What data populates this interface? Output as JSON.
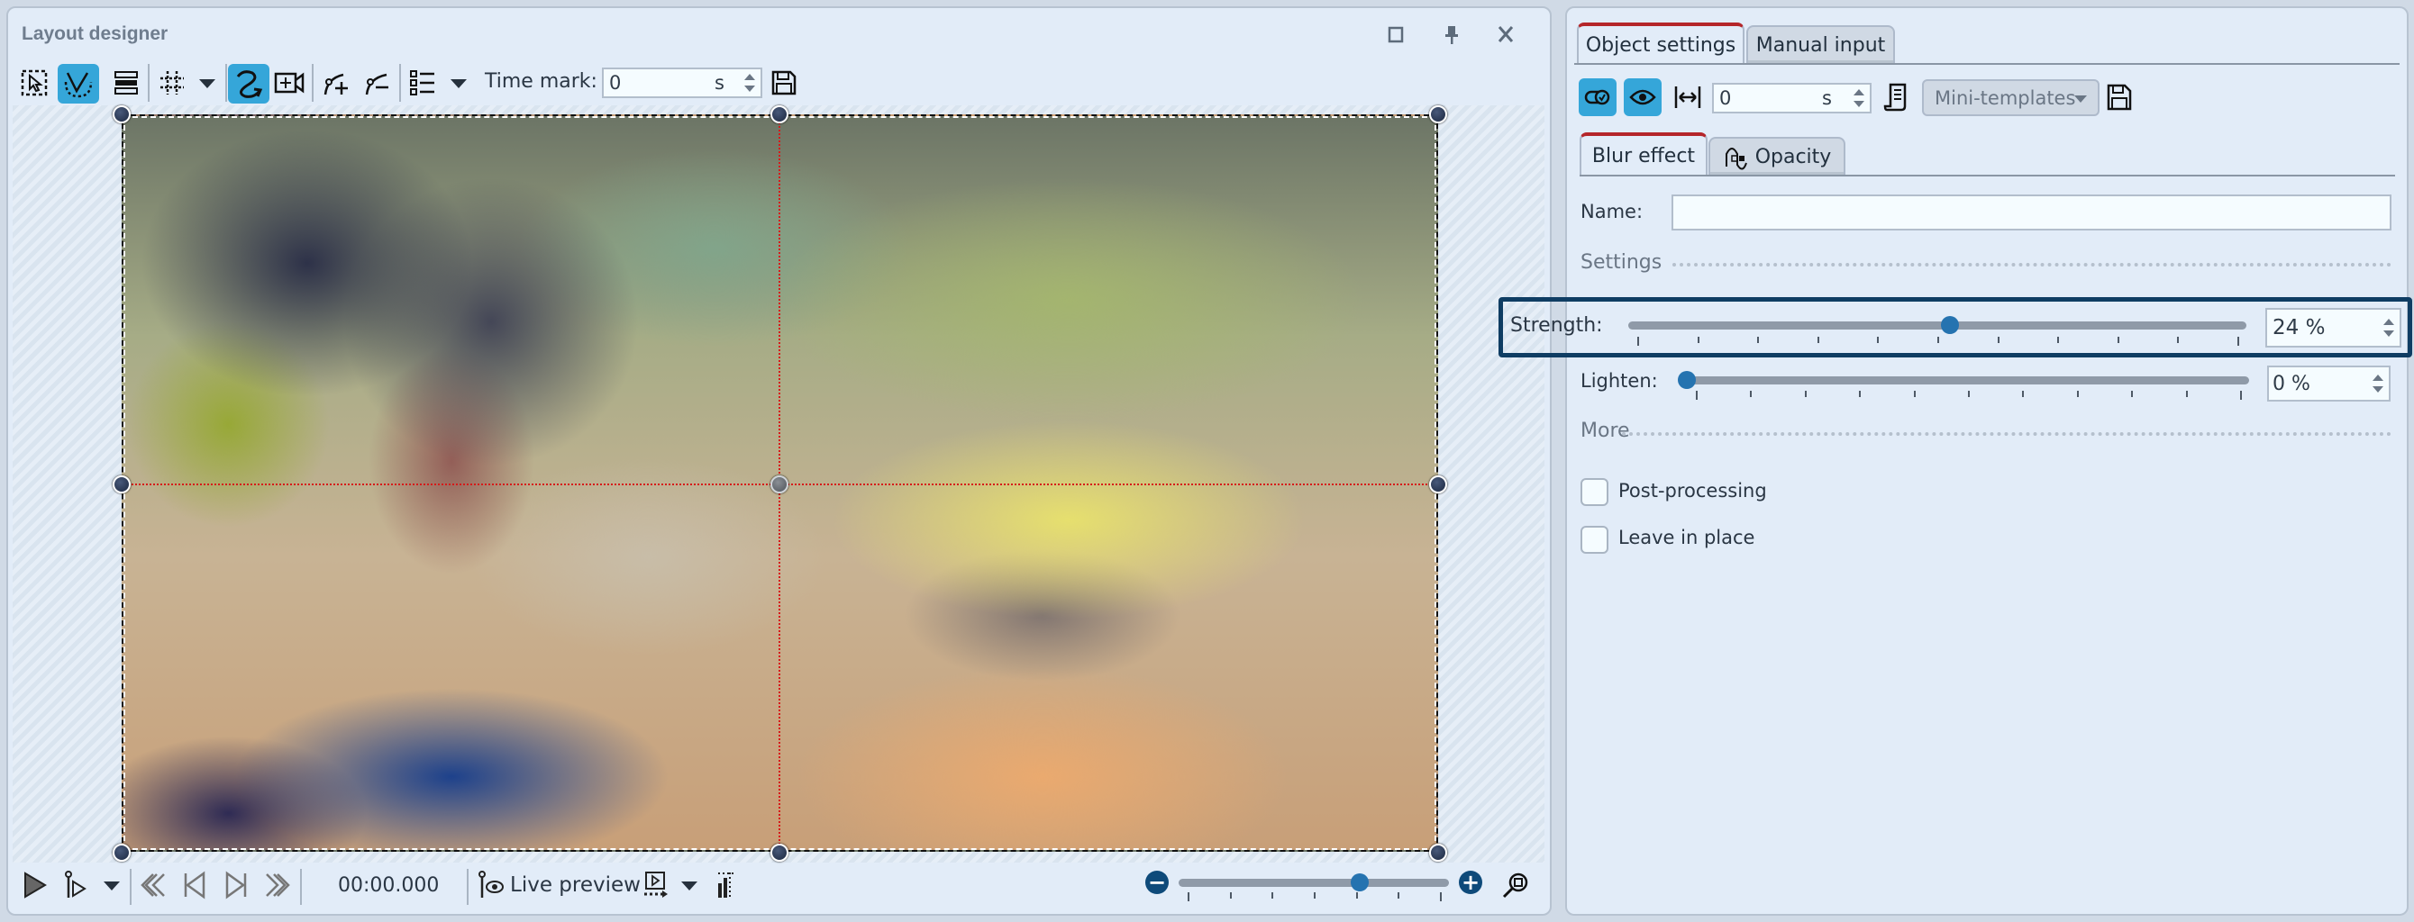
{
  "layout_designer": {
    "title": "Layout designer",
    "window_buttons": {
      "maximize_icon": "square-icon",
      "pin_icon": "pin-icon",
      "close_label": "X"
    },
    "toolbar": {
      "time_mark_label": "Time mark:",
      "time_mark_value": "0",
      "time_mark_unit": "s",
      "tools": [
        {
          "name": "selection-tool",
          "active": false
        },
        {
          "name": "bezier-tool",
          "active": true
        },
        {
          "name": "layers-tool",
          "active": false
        },
        {
          "name": "grid-tool",
          "active": false
        },
        {
          "name": "motion-path-tool",
          "active": true
        },
        {
          "name": "camera-pan-tool",
          "active": false
        },
        {
          "name": "add-point-tool",
          "active": false
        },
        {
          "name": "remove-point-tool",
          "active": false
        },
        {
          "name": "list-tool",
          "active": false
        }
      ]
    },
    "playback": {
      "time": "00:00.000",
      "live_preview_label": "Live preview",
      "zoom_level_fraction": 0.67
    }
  },
  "object_panel": {
    "tabs": [
      {
        "label": "Object settings",
        "active": true
      },
      {
        "label": "Manual input",
        "active": false
      }
    ],
    "toolbar": {
      "duration_value": "0",
      "duration_unit": "s",
      "mini_templates_label": "Mini-templates"
    },
    "effect_tabs": [
      {
        "label": "Blur effect",
        "active": true
      },
      {
        "label": "Opacity",
        "active": false
      }
    ],
    "name_label": "Name:",
    "name_value": "",
    "settings_section": "Settings",
    "strength": {
      "label": "Strength:",
      "value": "24 %",
      "slider_fraction": 0.52
    },
    "lighten": {
      "label": "Lighten:",
      "value": "0 %",
      "slider_fraction": 0.0
    },
    "more_section": "More",
    "checkboxes": [
      {
        "label": "Post-processing",
        "checked": false
      },
      {
        "label": "Leave in place",
        "checked": false
      }
    ]
  },
  "colors": {
    "accent_blue": "#35a6d9",
    "active_tab_red": "#b5262a",
    "highlight_navy": "#0f3d63",
    "guide_red": "#d61a1a"
  }
}
